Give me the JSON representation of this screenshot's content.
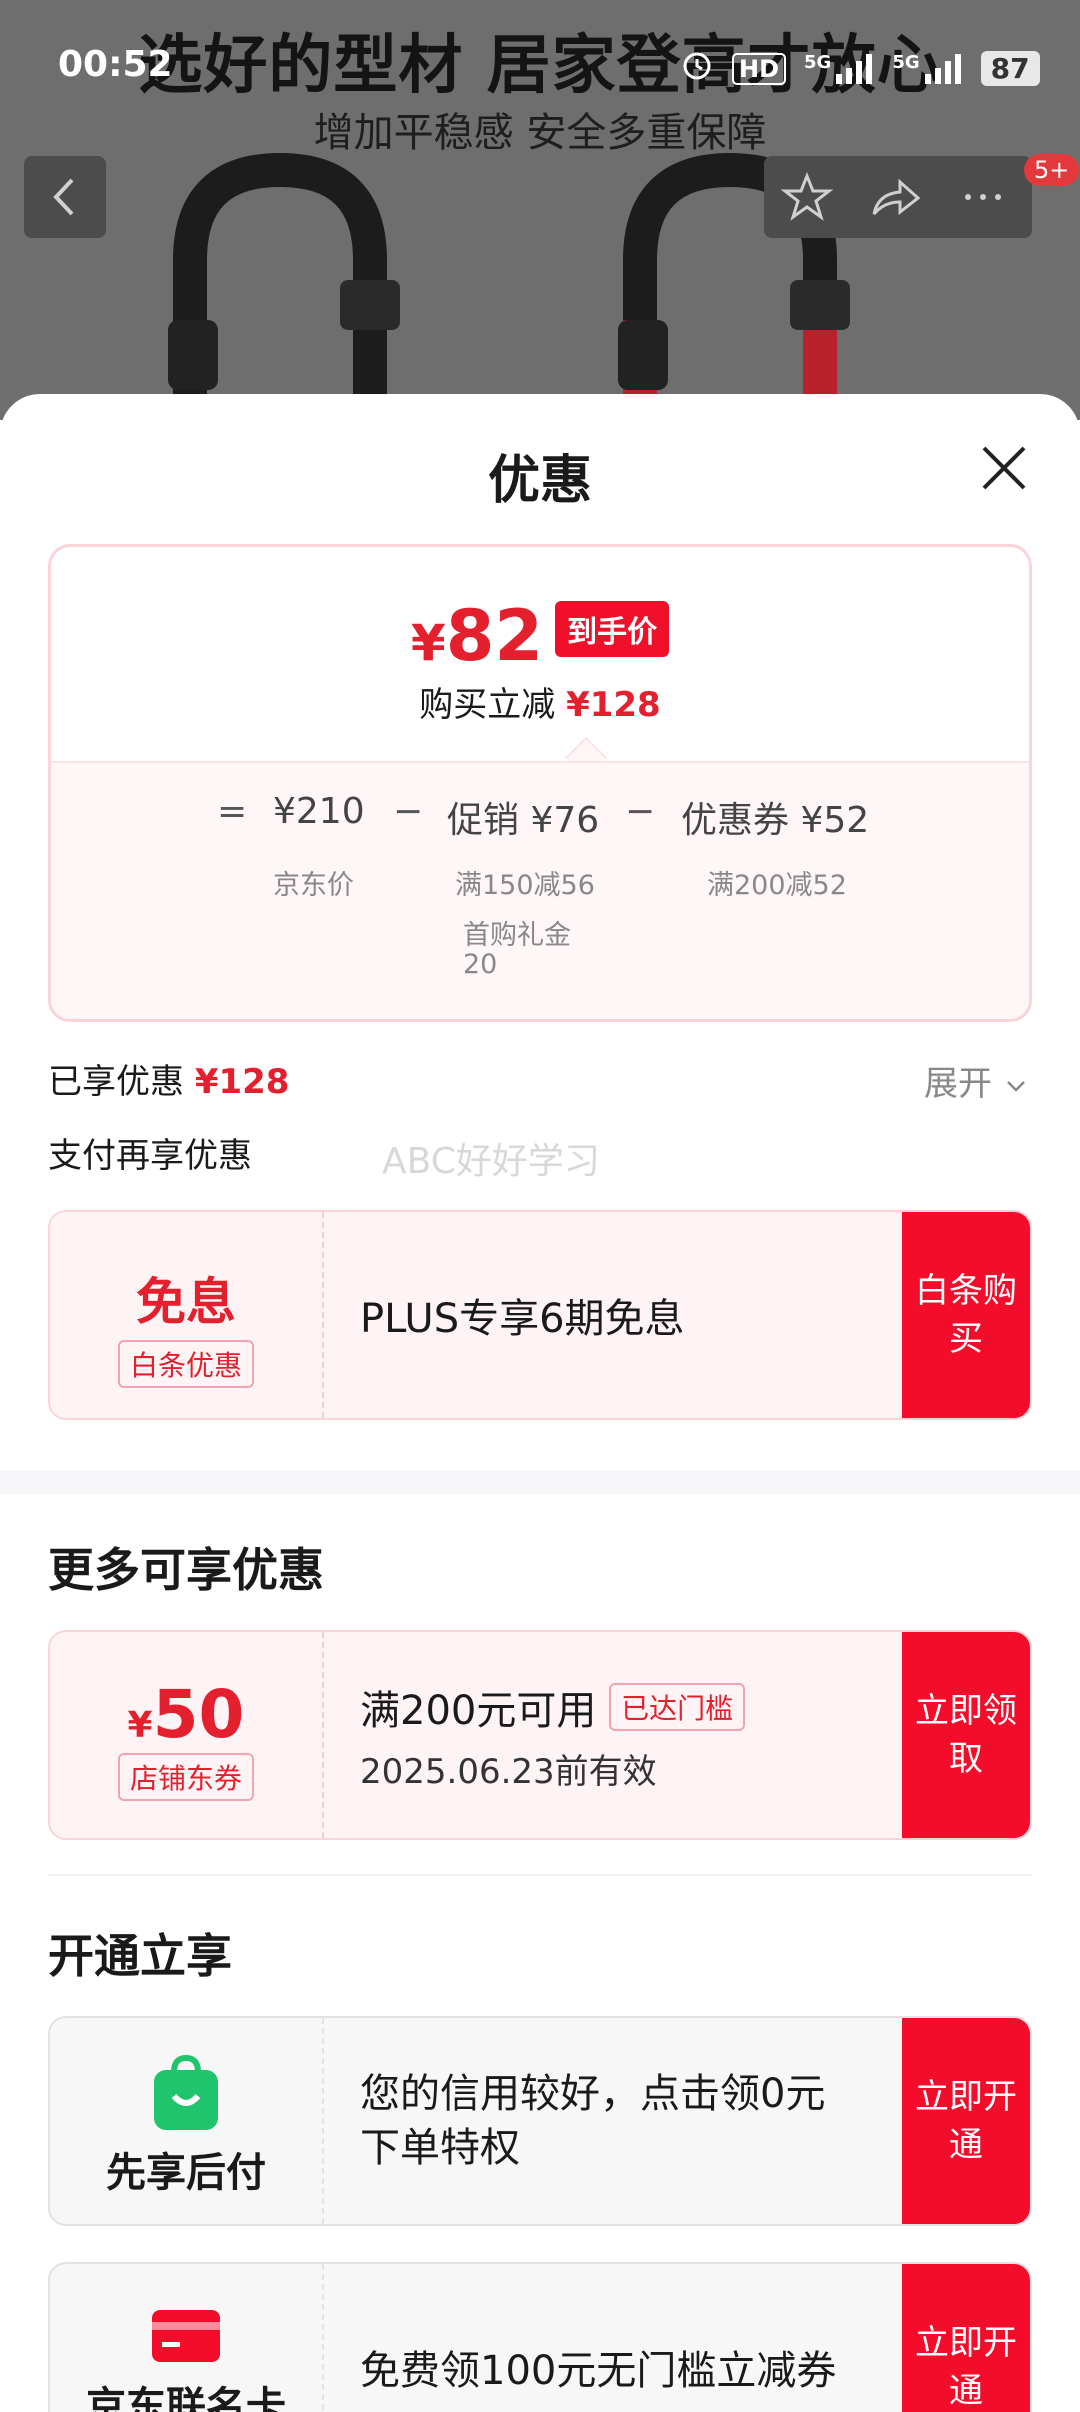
{
  "background": {
    "headline": "选好的型材 居家登高才放心",
    "subline": "增加平稳感 安全多重保障"
  },
  "status_bar": {
    "time": "00:52",
    "hd": "HD",
    "net1": "5G",
    "net2": "5G",
    "battery": "87"
  },
  "nav": {
    "badge": "5+"
  },
  "sheet": {
    "title": "优惠"
  },
  "price_card": {
    "currency": "¥",
    "final_price": "82",
    "final_tag": "到手价",
    "reduce_label": "购买立减",
    "reduce_value": "¥128",
    "eq": "=",
    "minus": "−",
    "jd_price": "¥210",
    "jd_label": "京东价",
    "promo_label": "促销",
    "promo_value": "¥76",
    "promo_note1": "满150减56",
    "promo_note2": "首购礼金",
    "promo_note3": "20",
    "coupon_label": "优惠券",
    "coupon_value": "¥52",
    "coupon_note": "满200减52"
  },
  "enjoyed": {
    "label": "已享优惠",
    "value": "¥128",
    "expand": "展开"
  },
  "pay_section": {
    "title": "支付再享优惠",
    "watermark": "ABC好好学习"
  },
  "baitiao": {
    "big": "免息",
    "tag": "白条优惠",
    "desc": "PLUS专享6期免息",
    "button": "白条购买"
  },
  "more_section": {
    "title": "更多可享优惠"
  },
  "store_coupon": {
    "currency": "¥",
    "amount": "50",
    "tag": "店铺东券",
    "condition": "满200元可用",
    "status": "已达门槛",
    "expiry": "2025.06.23前有效",
    "button": "立即领取"
  },
  "open_section": {
    "title": "开通立享"
  },
  "pay_later": {
    "name": "先享后付",
    "desc": "您的信用较好，点击领0元下单特权",
    "button": "立即开通"
  },
  "jd_card": {
    "name": "京东联名卡",
    "desc": "免费领100元无门槛立减券",
    "button": "立即开通"
  },
  "colors": {
    "accent": "#f30d2b",
    "price_red": "#e4202f",
    "green": "#1fc46c"
  }
}
